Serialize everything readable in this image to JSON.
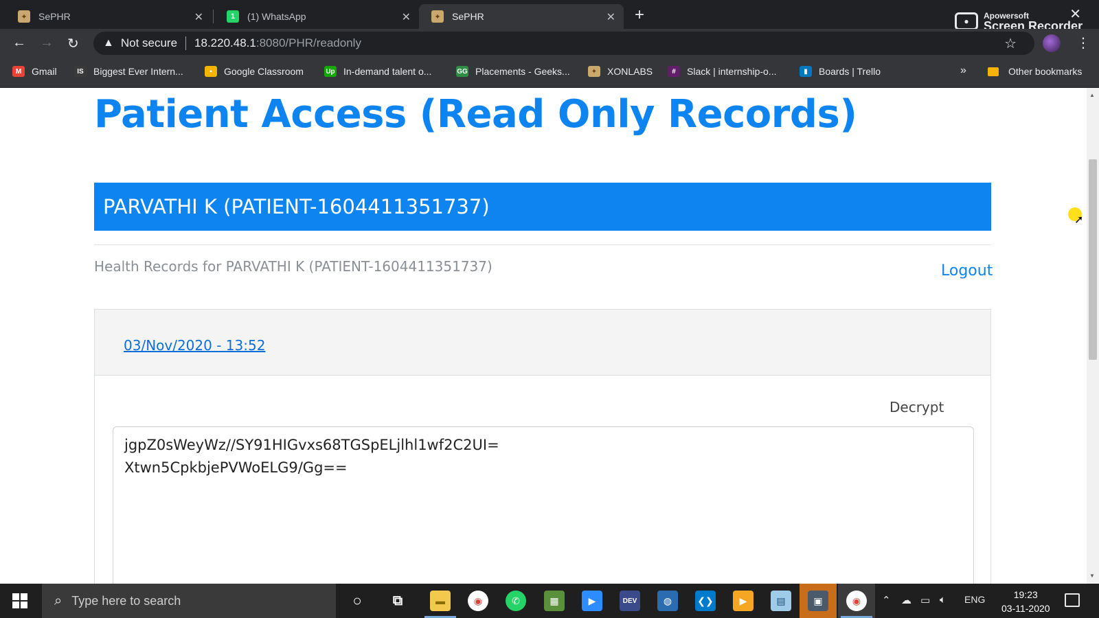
{
  "browser": {
    "tabs": [
      {
        "title": "SePHR",
        "active": false
      },
      {
        "title": "(1) WhatsApp",
        "active": false
      },
      {
        "title": "SePHR",
        "active": true
      }
    ],
    "recorder": {
      "brand": "Apowersoft",
      "product": "Screen Recorder"
    },
    "security_label": "Not secure",
    "url_host": "18.220.48.1",
    "url_path": ":8080/PHR/readonly",
    "bookmarks": [
      {
        "label": "Gmail",
        "icon": "gmail-icon",
        "color": "#ea4335"
      },
      {
        "label": "Biggest Ever Intern...",
        "icon": "internshala-icon",
        "color": "#3a3a3a"
      },
      {
        "label": "Google Classroom",
        "icon": "classroom-icon",
        "color": "#f4b400"
      },
      {
        "label": "In-demand talent o...",
        "icon": "upwork-icon",
        "color": "#14a800"
      },
      {
        "label": "Placements - Geeks...",
        "icon": "geeksforgeeks-icon",
        "color": "#2f8d46"
      },
      {
        "label": "XONLABS",
        "icon": "xonlabs-icon",
        "color": "#c9a96e"
      },
      {
        "label": "Slack | internship-o...",
        "icon": "slack-icon",
        "color": "#611f69"
      },
      {
        "label": "Boards | Trello",
        "icon": "trello-icon",
        "color": "#0079bf"
      }
    ],
    "other_bookmarks": "Other bookmarks"
  },
  "page": {
    "title": "Patient Access (Read Only Records)",
    "patient_banner": "PARVATHI K (PATIENT-1604411351737)",
    "records_heading": "Health Records for PARVATHI K (PATIENT-1604411351737)",
    "logout_label": "Logout",
    "record": {
      "date": "03/Nov/2020 - 13:52",
      "decrypt_label": "Decrypt",
      "ciphertext": "jgpZ0sWeyWz//SY91HIGvxs68TGSpELjlhl1wf2C2UI=\nXtwn5CpkbjePVWoELG9/Gg=="
    }
  },
  "colors": {
    "accent": "#0d84f0",
    "chrome_dark": "#202124",
    "chrome_toolbar": "#35363a"
  },
  "taskbar": {
    "search_placeholder": "Type here to search",
    "apps": [
      "cortana-icon",
      "task-view-icon",
      "file-explorer-icon",
      "chrome-icon",
      "whatsapp-icon",
      "minecraft-icon",
      "zoom-icon",
      "devcpp-icon",
      "screen-recorder-icon",
      "vscode-icon",
      "media-player-icon",
      "notepad-icon",
      "network-app-icon",
      "chrome-active-icon"
    ],
    "language": "ENG",
    "time": "19:23",
    "date": "03-11-2020"
  }
}
